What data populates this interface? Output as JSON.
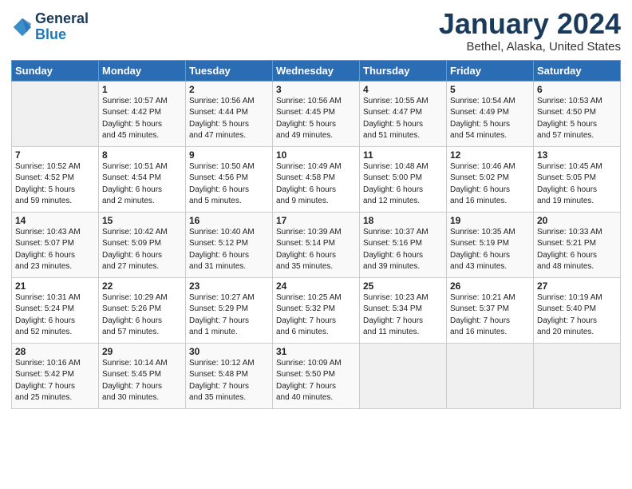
{
  "header": {
    "logo_line1": "General",
    "logo_line2": "Blue",
    "title": "January 2024",
    "location": "Bethel, Alaska, United States"
  },
  "weekdays": [
    "Sunday",
    "Monday",
    "Tuesday",
    "Wednesday",
    "Thursday",
    "Friday",
    "Saturday"
  ],
  "weeks": [
    [
      {
        "day": "",
        "info": ""
      },
      {
        "day": "1",
        "info": "Sunrise: 10:57 AM\nSunset: 4:42 PM\nDaylight: 5 hours\nand 45 minutes."
      },
      {
        "day": "2",
        "info": "Sunrise: 10:56 AM\nSunset: 4:44 PM\nDaylight: 5 hours\nand 47 minutes."
      },
      {
        "day": "3",
        "info": "Sunrise: 10:56 AM\nSunset: 4:45 PM\nDaylight: 5 hours\nand 49 minutes."
      },
      {
        "day": "4",
        "info": "Sunrise: 10:55 AM\nSunset: 4:47 PM\nDaylight: 5 hours\nand 51 minutes."
      },
      {
        "day": "5",
        "info": "Sunrise: 10:54 AM\nSunset: 4:49 PM\nDaylight: 5 hours\nand 54 minutes."
      },
      {
        "day": "6",
        "info": "Sunrise: 10:53 AM\nSunset: 4:50 PM\nDaylight: 5 hours\nand 57 minutes."
      }
    ],
    [
      {
        "day": "7",
        "info": "Sunrise: 10:52 AM\nSunset: 4:52 PM\nDaylight: 5 hours\nand 59 minutes."
      },
      {
        "day": "8",
        "info": "Sunrise: 10:51 AM\nSunset: 4:54 PM\nDaylight: 6 hours\nand 2 minutes."
      },
      {
        "day": "9",
        "info": "Sunrise: 10:50 AM\nSunset: 4:56 PM\nDaylight: 6 hours\nand 5 minutes."
      },
      {
        "day": "10",
        "info": "Sunrise: 10:49 AM\nSunset: 4:58 PM\nDaylight: 6 hours\nand 9 minutes."
      },
      {
        "day": "11",
        "info": "Sunrise: 10:48 AM\nSunset: 5:00 PM\nDaylight: 6 hours\nand 12 minutes."
      },
      {
        "day": "12",
        "info": "Sunrise: 10:46 AM\nSunset: 5:02 PM\nDaylight: 6 hours\nand 16 minutes."
      },
      {
        "day": "13",
        "info": "Sunrise: 10:45 AM\nSunset: 5:05 PM\nDaylight: 6 hours\nand 19 minutes."
      }
    ],
    [
      {
        "day": "14",
        "info": "Sunrise: 10:43 AM\nSunset: 5:07 PM\nDaylight: 6 hours\nand 23 minutes."
      },
      {
        "day": "15",
        "info": "Sunrise: 10:42 AM\nSunset: 5:09 PM\nDaylight: 6 hours\nand 27 minutes."
      },
      {
        "day": "16",
        "info": "Sunrise: 10:40 AM\nSunset: 5:12 PM\nDaylight: 6 hours\nand 31 minutes."
      },
      {
        "day": "17",
        "info": "Sunrise: 10:39 AM\nSunset: 5:14 PM\nDaylight: 6 hours\nand 35 minutes."
      },
      {
        "day": "18",
        "info": "Sunrise: 10:37 AM\nSunset: 5:16 PM\nDaylight: 6 hours\nand 39 minutes."
      },
      {
        "day": "19",
        "info": "Sunrise: 10:35 AM\nSunset: 5:19 PM\nDaylight: 6 hours\nand 43 minutes."
      },
      {
        "day": "20",
        "info": "Sunrise: 10:33 AM\nSunset: 5:21 PM\nDaylight: 6 hours\nand 48 minutes."
      }
    ],
    [
      {
        "day": "21",
        "info": "Sunrise: 10:31 AM\nSunset: 5:24 PM\nDaylight: 6 hours\nand 52 minutes."
      },
      {
        "day": "22",
        "info": "Sunrise: 10:29 AM\nSunset: 5:26 PM\nDaylight: 6 hours\nand 57 minutes."
      },
      {
        "day": "23",
        "info": "Sunrise: 10:27 AM\nSunset: 5:29 PM\nDaylight: 7 hours\nand 1 minute."
      },
      {
        "day": "24",
        "info": "Sunrise: 10:25 AM\nSunset: 5:32 PM\nDaylight: 7 hours\nand 6 minutes."
      },
      {
        "day": "25",
        "info": "Sunrise: 10:23 AM\nSunset: 5:34 PM\nDaylight: 7 hours\nand 11 minutes."
      },
      {
        "day": "26",
        "info": "Sunrise: 10:21 AM\nSunset: 5:37 PM\nDaylight: 7 hours\nand 16 minutes."
      },
      {
        "day": "27",
        "info": "Sunrise: 10:19 AM\nSunset: 5:40 PM\nDaylight: 7 hours\nand 20 minutes."
      }
    ],
    [
      {
        "day": "28",
        "info": "Sunrise: 10:16 AM\nSunset: 5:42 PM\nDaylight: 7 hours\nand 25 minutes."
      },
      {
        "day": "29",
        "info": "Sunrise: 10:14 AM\nSunset: 5:45 PM\nDaylight: 7 hours\nand 30 minutes."
      },
      {
        "day": "30",
        "info": "Sunrise: 10:12 AM\nSunset: 5:48 PM\nDaylight: 7 hours\nand 35 minutes."
      },
      {
        "day": "31",
        "info": "Sunrise: 10:09 AM\nSunset: 5:50 PM\nDaylight: 7 hours\nand 40 minutes."
      },
      {
        "day": "",
        "info": ""
      },
      {
        "day": "",
        "info": ""
      },
      {
        "day": "",
        "info": ""
      }
    ]
  ]
}
